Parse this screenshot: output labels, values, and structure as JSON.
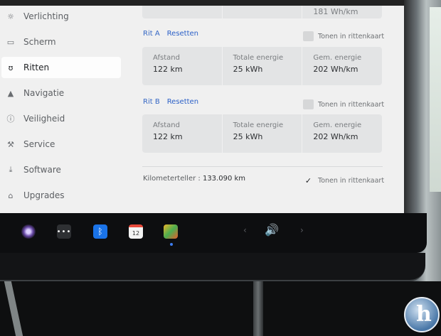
{
  "sidebar": {
    "items": [
      {
        "label": "Verlichting",
        "icon": "sun-icon"
      },
      {
        "label": "Scherm",
        "icon": "screen-icon"
      },
      {
        "label": "Ritten",
        "icon": "trips-icon",
        "active": true
      },
      {
        "label": "Navigatie",
        "icon": "navigation-arrow-icon"
      },
      {
        "label": "Veiligheid",
        "icon": "safety-icon"
      },
      {
        "label": "Service",
        "icon": "wrench-icon"
      },
      {
        "label": "Software",
        "icon": "download-icon"
      },
      {
        "label": "Upgrades",
        "icon": "bag-icon"
      }
    ]
  },
  "top_panel": {
    "partial_value": "181 Wh/km"
  },
  "trips": [
    {
      "name": "Rit A",
      "reset_label": "Resetten",
      "toggle_label": "Tonen in rittenkaart",
      "checked": false,
      "stats": [
        {
          "label": "Afstand",
          "value": "122 km"
        },
        {
          "label": "Totale energie",
          "value": "25 kWh"
        },
        {
          "label": "Gem. energie",
          "value": "202 Wh/km"
        }
      ]
    },
    {
      "name": "Rit B",
      "reset_label": "Resetten",
      "toggle_label": "Tonen in rittenkaart",
      "checked": false,
      "stats": [
        {
          "label": "Afstand",
          "value": "122 km"
        },
        {
          "label": "Totale energie",
          "value": "25 kWh"
        },
        {
          "label": "Gem. energie",
          "value": "202 Wh/km"
        }
      ]
    }
  ],
  "odometer": {
    "label": "Kilometerteller :",
    "value": "133.090 km",
    "toggle_label": "Tonen in rittenkaart",
    "checked": true,
    "check_glyph": "✓"
  },
  "dock": {
    "calendar_day": "12",
    "dots_glyph": "•••",
    "bluetooth_glyph": "ᛒ",
    "prev_glyph": "‹",
    "next_glyph": "›",
    "volume_glyph": "🔊"
  },
  "watermark": {
    "letter": "h"
  },
  "colors": {
    "accent": "#3466c4",
    "bluetooth": "#1a73e8",
    "screen_bg": "#f0f0f0",
    "panel_bg": "#e3e4e5"
  }
}
